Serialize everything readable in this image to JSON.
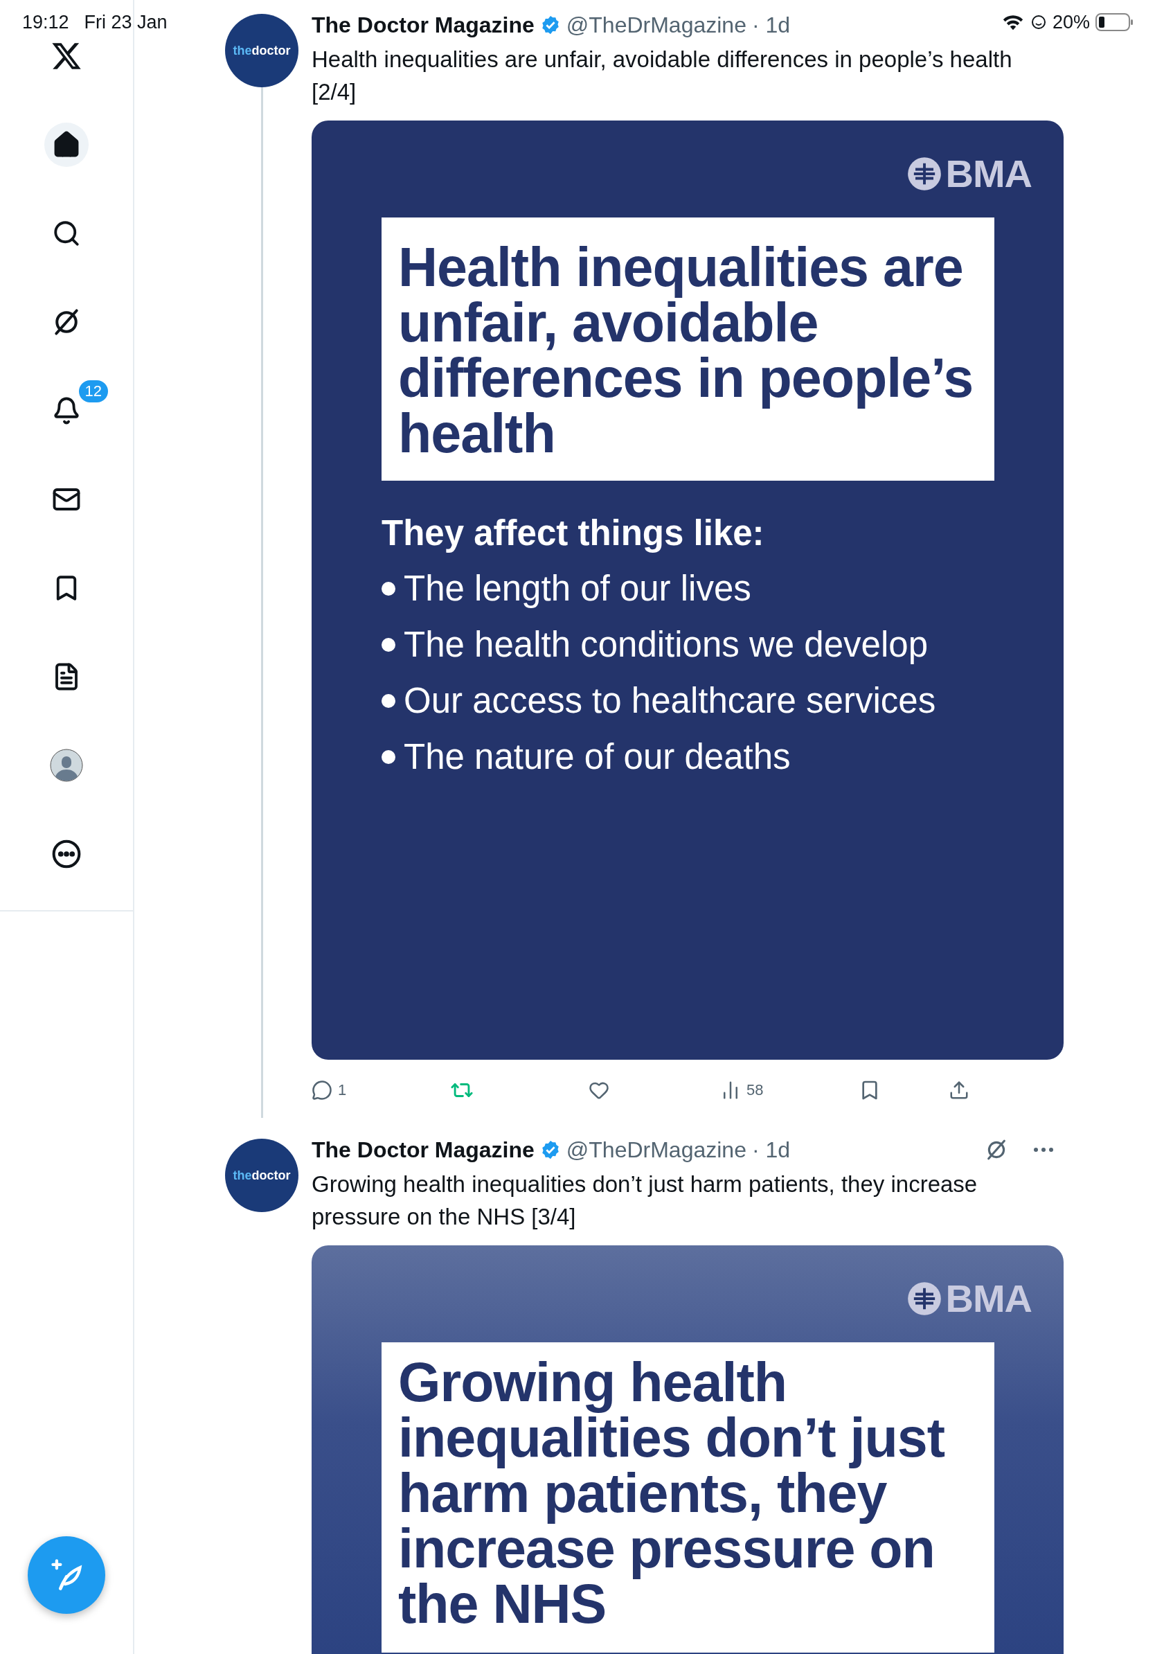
{
  "status_bar": {
    "time": "19:12",
    "date": "Fri 23 Jan",
    "battery": "20%"
  },
  "sidebar": {
    "items": [
      {
        "kind": "home",
        "selected": true
      },
      {
        "kind": "search",
        "selected": false
      },
      {
        "kind": "grok",
        "selected": false
      },
      {
        "kind": "notifications",
        "selected": false,
        "badge": "12"
      },
      {
        "kind": "messages",
        "selected": false
      },
      {
        "kind": "bookmarks",
        "selected": false
      },
      {
        "kind": "lists",
        "selected": false
      },
      {
        "kind": "profile",
        "selected": false
      },
      {
        "kind": "more",
        "selected": false
      }
    ]
  },
  "tweets": [
    {
      "avatar": {
        "prefix": "the",
        "name": "doctor"
      },
      "author": "The Doctor Magazine",
      "verified": true,
      "handle": "@TheDrMagazine",
      "time": "· 1d",
      "header_menu": false,
      "text": "Health inequalities are unfair, avoidable differences in people’s health [2/4]",
      "image": {
        "kind": "graphic",
        "brand": "BMA",
        "headline": "Health inequalities are unfair, avoidable differences in people’s health",
        "subheading": "They affect things like:",
        "bullets": [
          "The length of our lives",
          "The health conditions we develop",
          "Our access to healthcare services",
          "The nature of our deaths"
        ]
      },
      "actions": {
        "replies": "1",
        "retweeted": true,
        "liked": false,
        "views": "58"
      }
    },
    {
      "avatar": {
        "prefix": "the",
        "name": "doctor"
      },
      "author": "The Doctor Magazine",
      "verified": true,
      "handle": "@TheDrMagazine",
      "time": "· 1d",
      "header_menu": true,
      "text": "Growing health inequalities don’t just harm patients, they increase pressure on the NHS [3/4]",
      "image": {
        "kind": "photo",
        "brand": "BMA",
        "headline": "Growing health inequalities don’t just harm patients, they increase pressure on the NHS"
      }
    }
  ]
}
